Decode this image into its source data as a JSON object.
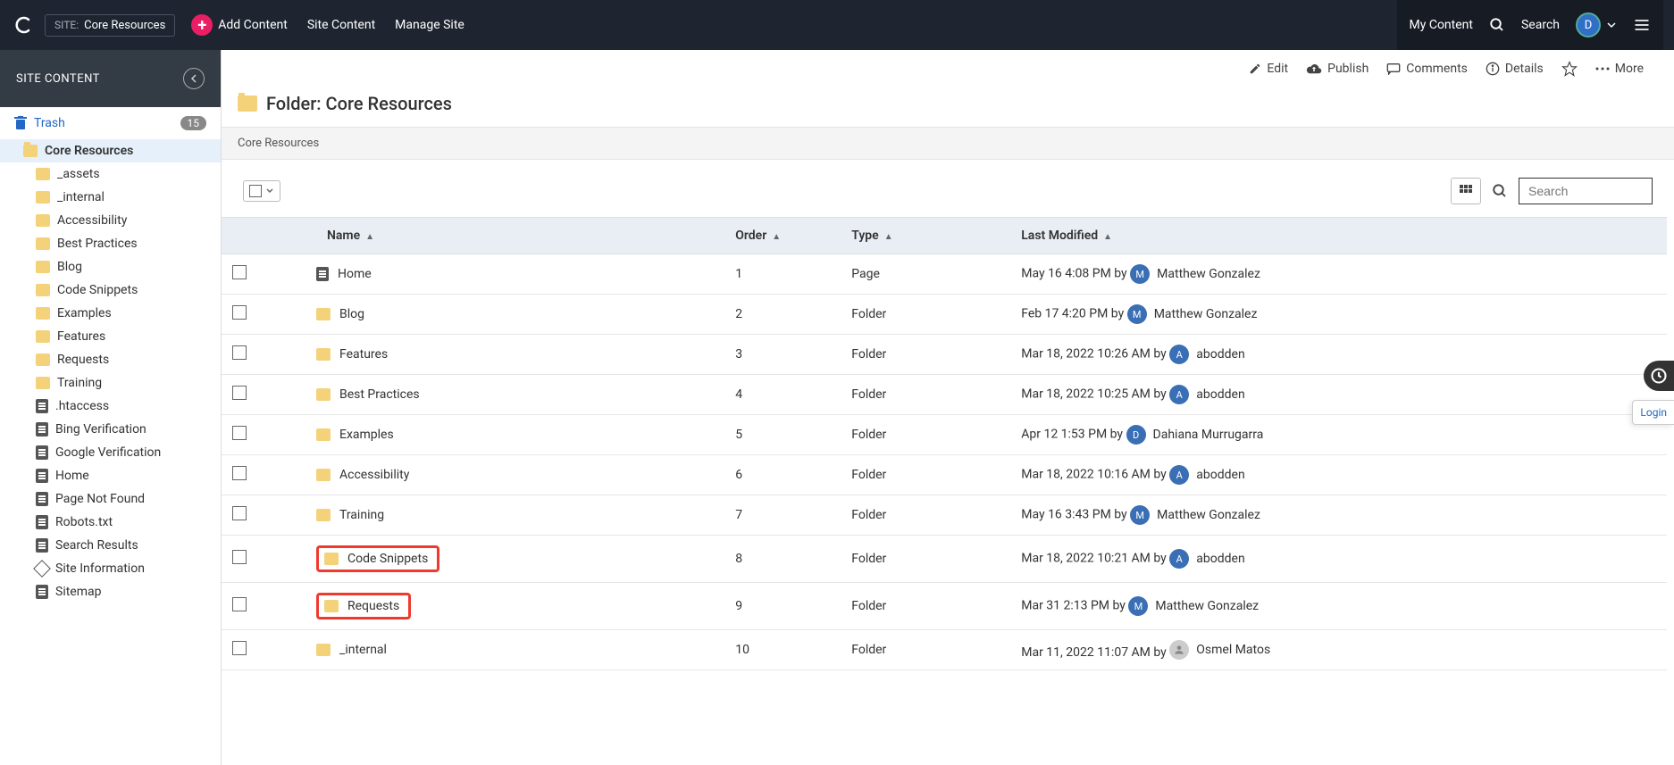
{
  "topbar": {
    "site_prefix": "SITE:",
    "site_name": "Core Resources",
    "add_content": "Add Content",
    "site_content": "Site Content",
    "manage_site": "Manage Site",
    "my_content": "My Content",
    "search": "Search",
    "user_initial": "D"
  },
  "sidebar": {
    "header": "SITE CONTENT",
    "trash_label": "Trash",
    "trash_count": "15",
    "root": "Core Resources",
    "children": [
      {
        "type": "folder",
        "label": "_assets"
      },
      {
        "type": "folder",
        "label": "_internal"
      },
      {
        "type": "folder",
        "label": "Accessibility"
      },
      {
        "type": "folder",
        "label": "Best Practices"
      },
      {
        "type": "folder",
        "label": "Blog"
      },
      {
        "type": "folder",
        "label": "Code Snippets"
      },
      {
        "type": "folder",
        "label": "Examples"
      },
      {
        "type": "folder",
        "label": "Features"
      },
      {
        "type": "folder",
        "label": "Requests"
      },
      {
        "type": "folder",
        "label": "Training"
      },
      {
        "type": "page",
        "label": ".htaccess"
      },
      {
        "type": "page",
        "label": "Bing Verification"
      },
      {
        "type": "page",
        "label": "Google Verification"
      },
      {
        "type": "page",
        "label": "Home"
      },
      {
        "type": "page",
        "label": "Page Not Found"
      },
      {
        "type": "page",
        "label": "Robots.txt"
      },
      {
        "type": "page",
        "label": "Search Results"
      },
      {
        "type": "block",
        "label": "Site Information"
      },
      {
        "type": "page",
        "label": "Sitemap"
      }
    ]
  },
  "actions": {
    "edit": "Edit",
    "publish": "Publish",
    "comments": "Comments",
    "details": "Details",
    "more": "More"
  },
  "page": {
    "title": "Folder: Core Resources",
    "breadcrumb": "Core Resources",
    "search_placeholder": "Search"
  },
  "table": {
    "cols": {
      "name": "Name",
      "order": "Order",
      "type": "Type",
      "modified": "Last Modified"
    },
    "rows": [
      {
        "icon": "page",
        "name": "Home",
        "order": "1",
        "type": "Page",
        "when": "May 16 4:08 PM by",
        "avi": "M",
        "avc": "#3a6fb5",
        "user": "Matthew Gonzalez",
        "hl": false
      },
      {
        "icon": "folder",
        "name": "Blog",
        "order": "2",
        "type": "Folder",
        "when": "Feb 17 4:20 PM by",
        "avi": "M",
        "avc": "#3a6fb5",
        "user": "Matthew Gonzalez",
        "hl": false
      },
      {
        "icon": "folder",
        "name": "Features",
        "order": "3",
        "type": "Folder",
        "when": "Mar 18, 2022 10:26 AM by",
        "avi": "A",
        "avc": "#3a6fb5",
        "user": "abodden",
        "hl": false
      },
      {
        "icon": "folder",
        "name": "Best Practices",
        "order": "4",
        "type": "Folder",
        "when": "Mar 18, 2022 10:25 AM by",
        "avi": "A",
        "avc": "#3a6fb5",
        "user": "abodden",
        "hl": false
      },
      {
        "icon": "folder",
        "name": "Examples",
        "order": "5",
        "type": "Folder",
        "when": "Apr 12 1:53 PM by",
        "avi": "D",
        "avc": "#3a6fb5",
        "user": "Dahiana Murrugarra",
        "hl": false
      },
      {
        "icon": "folder",
        "name": "Accessibility",
        "order": "6",
        "type": "Folder",
        "when": "Mar 18, 2022 10:16 AM by",
        "avi": "A",
        "avc": "#3a6fb5",
        "user": "abodden",
        "hl": false
      },
      {
        "icon": "folder",
        "name": "Training",
        "order": "7",
        "type": "Folder",
        "when": "May 16 3:43 PM by",
        "avi": "M",
        "avc": "#3a6fb5",
        "user": "Matthew Gonzalez",
        "hl": false
      },
      {
        "icon": "folder",
        "name": "Code Snippets",
        "order": "8",
        "type": "Folder",
        "when": "Mar 18, 2022 10:21 AM by",
        "avi": "A",
        "avc": "#3a6fb5",
        "user": "abodden",
        "hl": true
      },
      {
        "icon": "folder",
        "name": "Requests",
        "order": "9",
        "type": "Folder",
        "when": "Mar 31 2:13 PM by",
        "avi": "M",
        "avc": "#3a6fb5",
        "user": "Matthew Gonzalez",
        "hl": true
      },
      {
        "icon": "folder",
        "name": "_internal",
        "order": "10",
        "type": "Folder",
        "when": "Mar 11, 2022 11:07 AM by",
        "avi": "",
        "avc": "#ccc",
        "user": "Osmel Matos",
        "hl": false
      }
    ]
  },
  "float": {
    "login": "Login"
  }
}
